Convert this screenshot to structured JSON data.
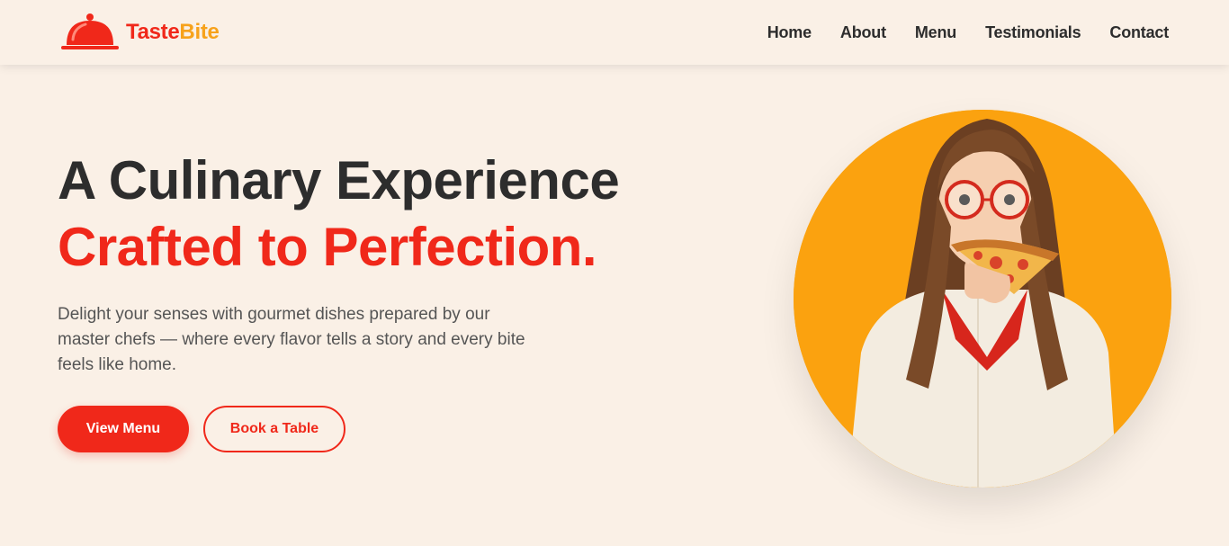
{
  "brand": {
    "name_part1": "Taste",
    "name_part2": "Bite",
    "primary_color": "#f0281a",
    "accent_color": "#f7a21b",
    "icon": "cloche-icon"
  },
  "nav": {
    "items": [
      {
        "label": "Home"
      },
      {
        "label": "About"
      },
      {
        "label": "Menu"
      },
      {
        "label": "Testimonials"
      },
      {
        "label": "Contact"
      }
    ]
  },
  "hero": {
    "title_line1": "A Culinary Experience",
    "title_line2": "Crafted to Perfection.",
    "description": "Delight your senses with gourmet dishes prepared by our master chefs — where every flavor tells a story and every bite feels like home.",
    "primary_button": "View Menu",
    "secondary_button": "Book a Table",
    "image_bg_color": "#fba20f"
  }
}
